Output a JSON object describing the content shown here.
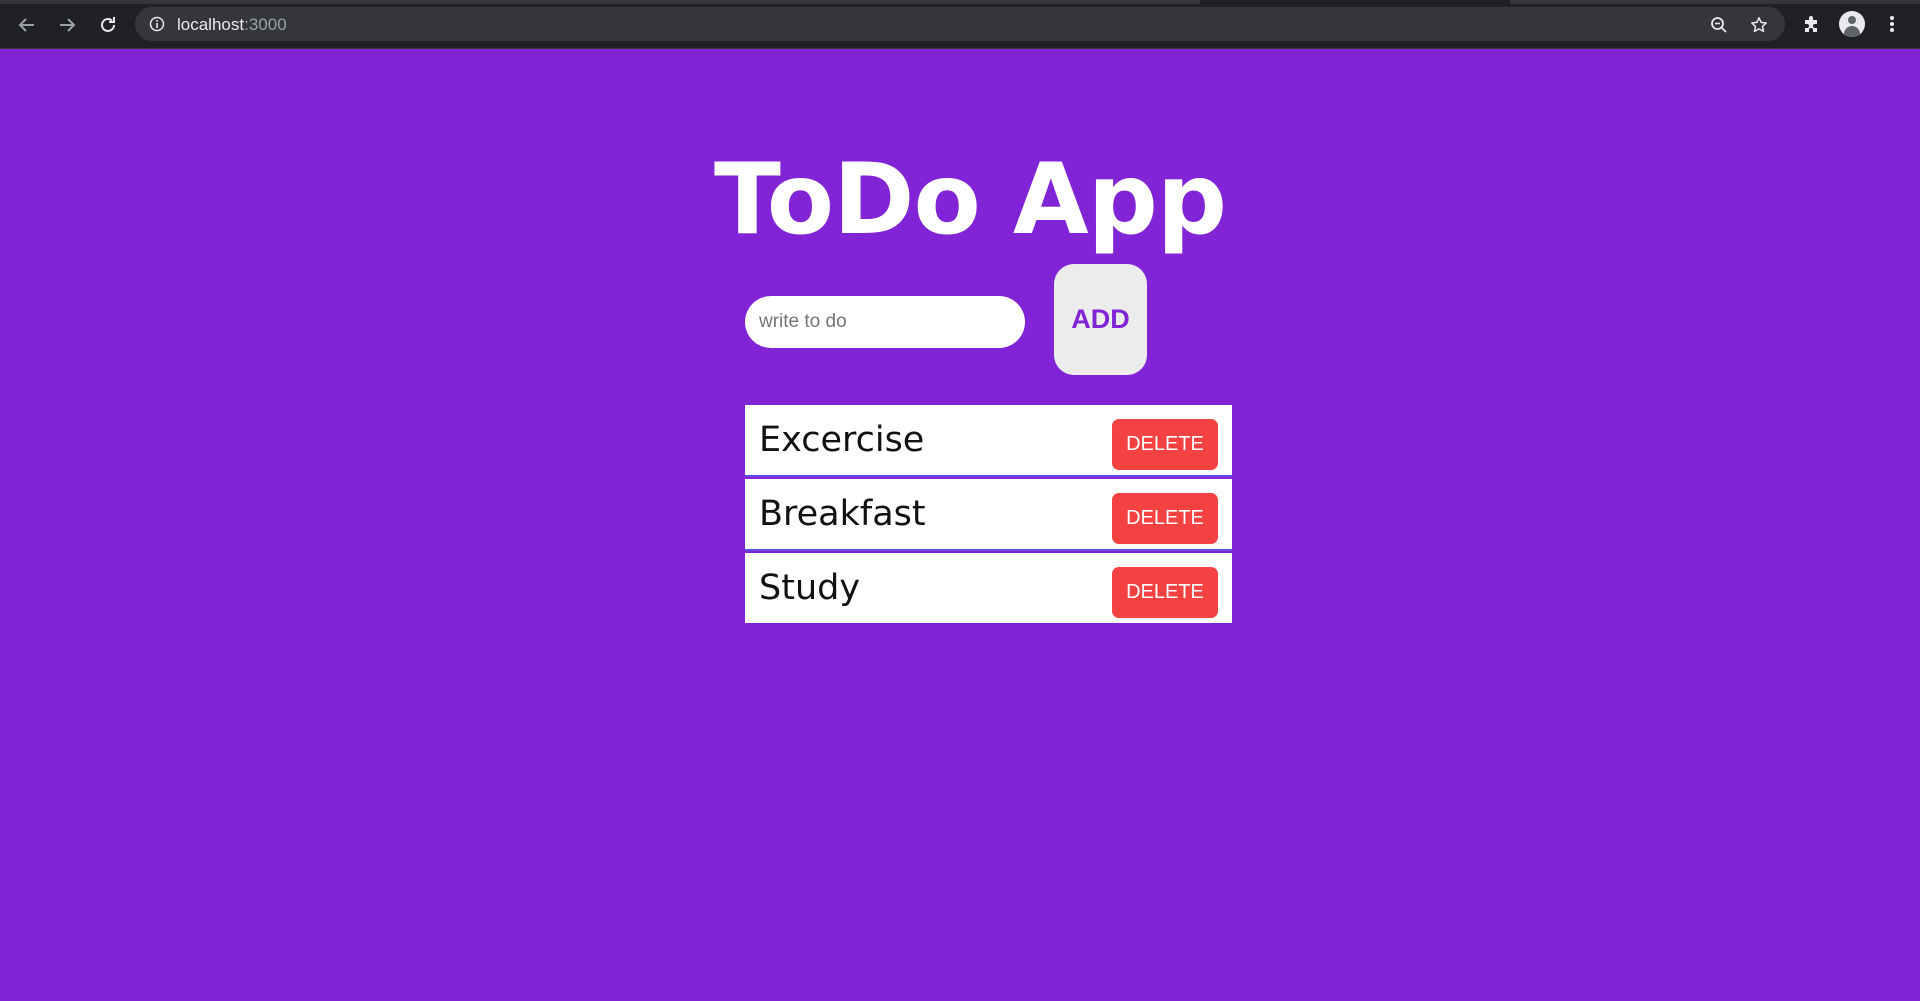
{
  "browser": {
    "url_host": "localhost",
    "url_port": ":3000",
    "icons": {
      "back": "back-arrow-icon",
      "forward": "forward-arrow-icon",
      "reload": "reload-icon",
      "info": "info-icon",
      "zoom": "zoom-out-icon",
      "bookmark": "star-icon",
      "extensions": "puzzle-icon",
      "profile": "avatar",
      "menu": "kebab-menu-icon"
    }
  },
  "app": {
    "title": "ToDo App",
    "input_placeholder": "write to do",
    "input_value": "",
    "add_label": "ADD",
    "delete_label": "DELETE",
    "todos": [
      {
        "text": "Excercise"
      },
      {
        "text": "Breakfast"
      },
      {
        "text": "Study"
      }
    ]
  },
  "colors": {
    "background": "#8124d6",
    "delete": "#f44242",
    "add_text": "#8124d6",
    "divider": "#5a4ce0"
  }
}
